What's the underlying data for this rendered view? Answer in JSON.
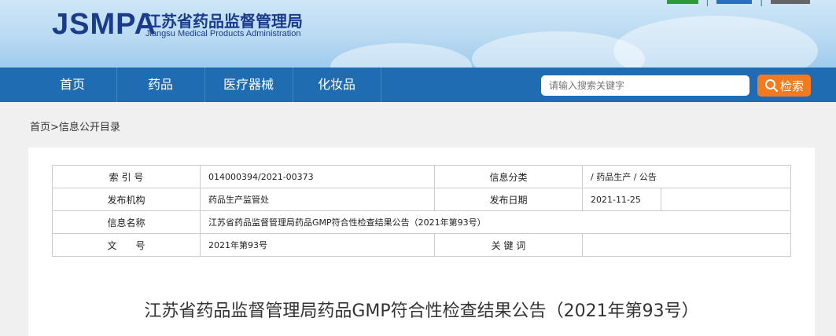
{
  "header": {
    "logo_en": "JSMPA",
    "logo_cn": "江苏省药品监督管理局",
    "logo_sub": "Jiangsu Medical Products Administration",
    "toplinks": [
      "|",
      "|"
    ]
  },
  "nav": {
    "items": [
      "首页",
      "药品",
      "医疗器械",
      "化妆品"
    ],
    "search_placeholder": "请输入搜索关键字",
    "search_button": "检索"
  },
  "breadcrumb": "首页>信息公开目录",
  "info": {
    "index_label": "索 引 号",
    "index_value": "014000394/2021-00373",
    "category_label": "信息分类",
    "category_value": "/  药品生产  /  公告",
    "publisher_label": "发布机构",
    "publisher_value": "药品生产监管处",
    "date_label": "发布日期",
    "date_value": "2021-11-25",
    "name_label": "信息名称",
    "name_value": "江苏省药品监督管理局药品GMP符合性检查结果公告（2021年第93号）",
    "doc_label": "文　　号",
    "doc_value": "2021年第93号",
    "keywords_label": "关 键 词",
    "keywords_value": ""
  },
  "article": {
    "title": "江苏省药品监督管理局药品GMP符合性检查结果公告（2021年第93号）"
  },
  "colors": {
    "nav_bg": "#1f6cb2",
    "search_btn": "#f47a20",
    "logo": "#1a3b8c"
  }
}
